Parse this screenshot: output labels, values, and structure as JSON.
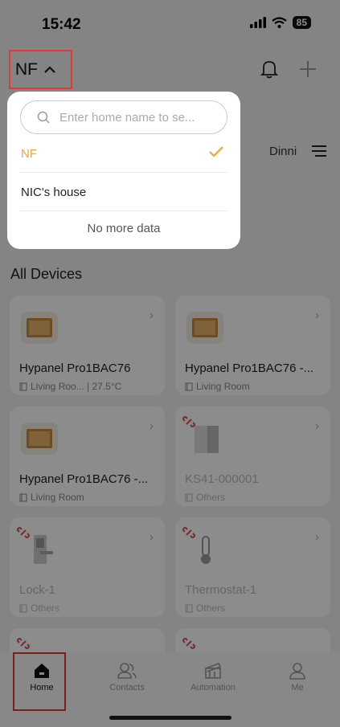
{
  "status": {
    "time": "15:42",
    "battery": "85"
  },
  "header": {
    "home_name": "NF"
  },
  "rooms": {
    "partial_tab": "Dinni"
  },
  "section": {
    "all_devices": "All Devices"
  },
  "devices": [
    {
      "name": "Hypanel Pro1BAC76",
      "meta": "Living Roo... | 27.5°C",
      "online": true,
      "icon": "panel-icon"
    },
    {
      "name": "Hypanel Pro1BAC76 -...",
      "meta": "Living Room",
      "online": true,
      "icon": "panel-icon"
    },
    {
      "name": "Hypanel Pro1BAC76 -...",
      "meta": "Living Room",
      "online": true,
      "icon": "panel-icon"
    },
    {
      "name": "KS41-000001",
      "meta": "Others",
      "online": false,
      "icon": "switch-icon"
    },
    {
      "name": "Lock-1",
      "meta": "Others",
      "online": false,
      "icon": "lock-icon"
    },
    {
      "name": "Thermostat-1",
      "meta": "Others",
      "online": false,
      "icon": "thermostat-icon"
    }
  ],
  "tabs": [
    {
      "label": "Home",
      "icon": "home-icon"
    },
    {
      "label": "Contacts",
      "icon": "contacts-icon"
    },
    {
      "label": "Automation",
      "icon": "automation-icon"
    },
    {
      "label": "Me",
      "icon": "person-icon"
    }
  ],
  "dropdown": {
    "search_placeholder": "Enter home name to se...",
    "homes": [
      {
        "label": "NF",
        "selected": true
      },
      {
        "label": "NIC's house",
        "selected": false
      }
    ],
    "footer": "No more data"
  },
  "colors": {
    "accent": "#f2a33a",
    "highlight_frame": "#e23a2f"
  }
}
